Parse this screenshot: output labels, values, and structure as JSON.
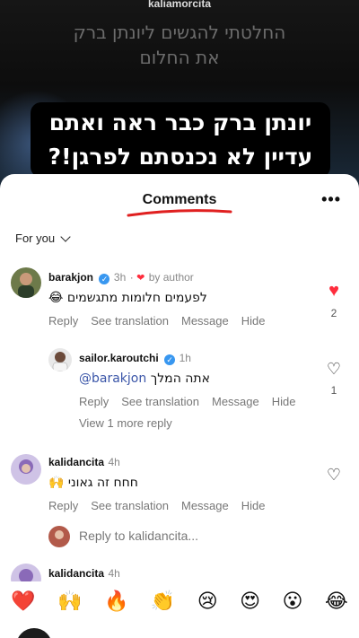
{
  "video": {
    "username": "kaliamorcita",
    "caption_faded_line1": "החלטתי להגשים ליונתן ברק",
    "caption_faded_line2": "את החלום",
    "headline_line1": "יונתן ברק כבר ראה ואתם",
    "headline_line2": "עדיין לא נכנסתם לפרגן!?"
  },
  "sheet": {
    "title": "Comments",
    "filter_label": "For you",
    "accent_red": "#e02020"
  },
  "comments": [
    {
      "username": "barakjon",
      "time": "3h",
      "author_liked": "by author",
      "emoji": "😂",
      "text": "לפעמים חלומות מתגשמים",
      "actions": [
        "Reply",
        "See translation",
        "Message",
        "Hide"
      ],
      "likes": "2",
      "liked": true
    },
    {
      "username": "sailor.karoutchi",
      "time": "1h",
      "mention": "@barakjon",
      "text": "אתה המלך",
      "actions": [
        "Reply",
        "See translation",
        "Message",
        "Hide"
      ],
      "likes": "1",
      "liked": false
    },
    {
      "username": "kalidancita",
      "time": "4h",
      "emoji": "🙌",
      "text": "חחח זה גאוני",
      "actions": [
        "Reply",
        "See translation",
        "Message",
        "Hide"
      ],
      "liked": false
    },
    {
      "username": "kalidancita",
      "time": "4h"
    }
  ],
  "view_more_replies": "View 1 more reply",
  "reply_prompt": "Reply to kalidancita...",
  "emoji_bar": [
    "❤️",
    "🙌",
    "🔥",
    "👏",
    "😢",
    "😍",
    "😮",
    "😂"
  ]
}
